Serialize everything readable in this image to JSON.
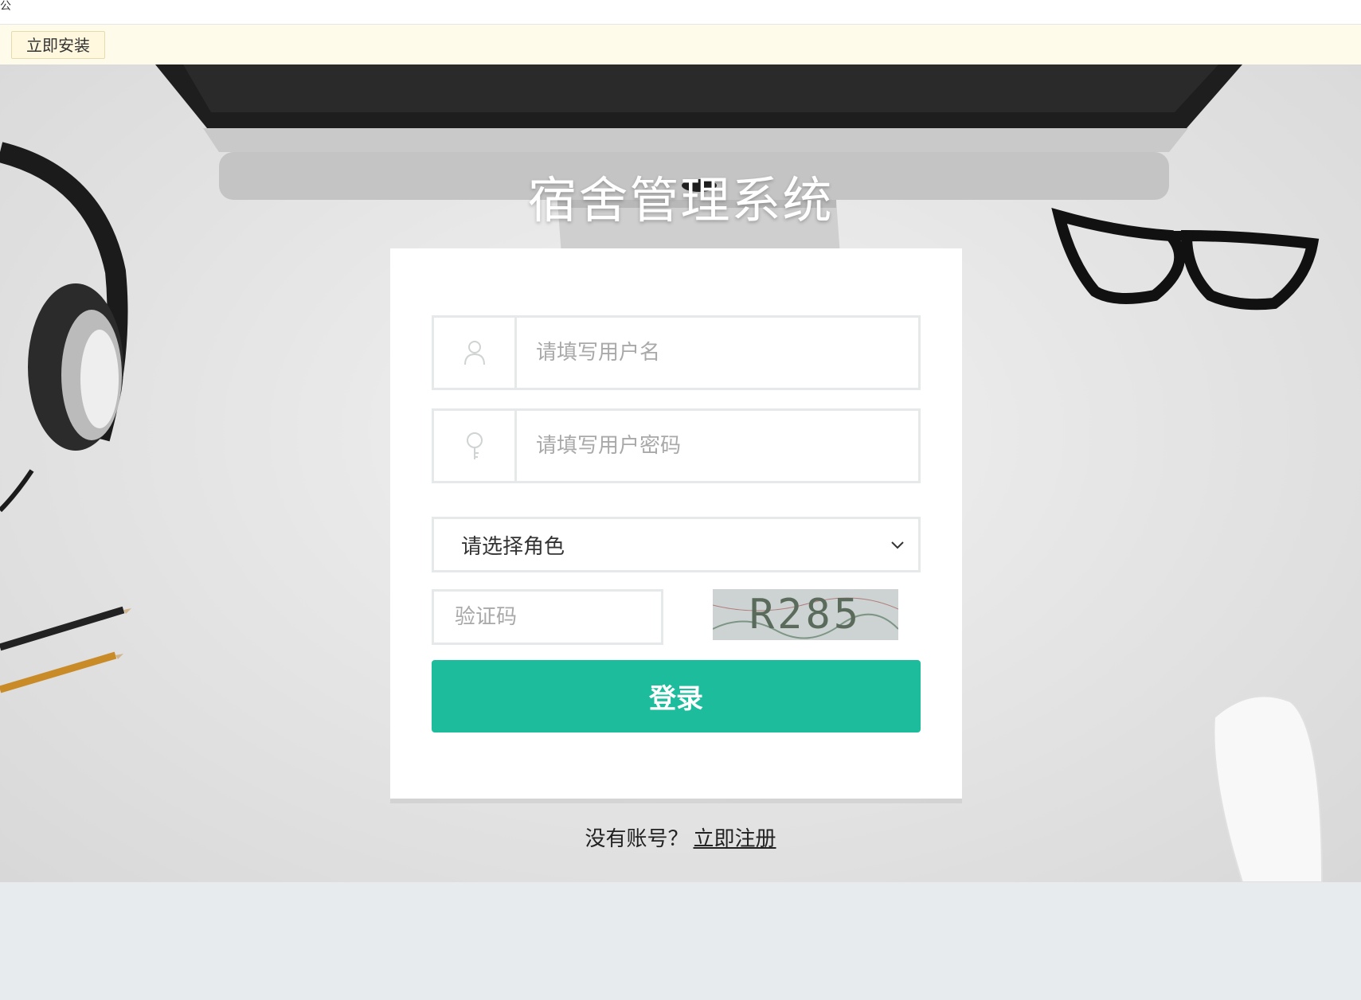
{
  "top_strip": {
    "glyph": "公"
  },
  "install_bar": {
    "button_label": "立即安装"
  },
  "login": {
    "title": "宿舍管理系统",
    "username_placeholder": "请填写用户名",
    "password_placeholder": "请填写用户密码",
    "role_select_value": "请选择角色",
    "captcha_placeholder": "验证码",
    "captcha_code": "R285",
    "submit_label": "登录"
  },
  "register": {
    "prompt": "没有账号？",
    "link_label": "立即注册"
  },
  "colors": {
    "accent": "#1cbc9c",
    "install_bar_bg": "#fffbea"
  },
  "icons": {
    "username": "user-icon",
    "password": "key-icon",
    "select_chevron": "chevron-down-icon"
  }
}
